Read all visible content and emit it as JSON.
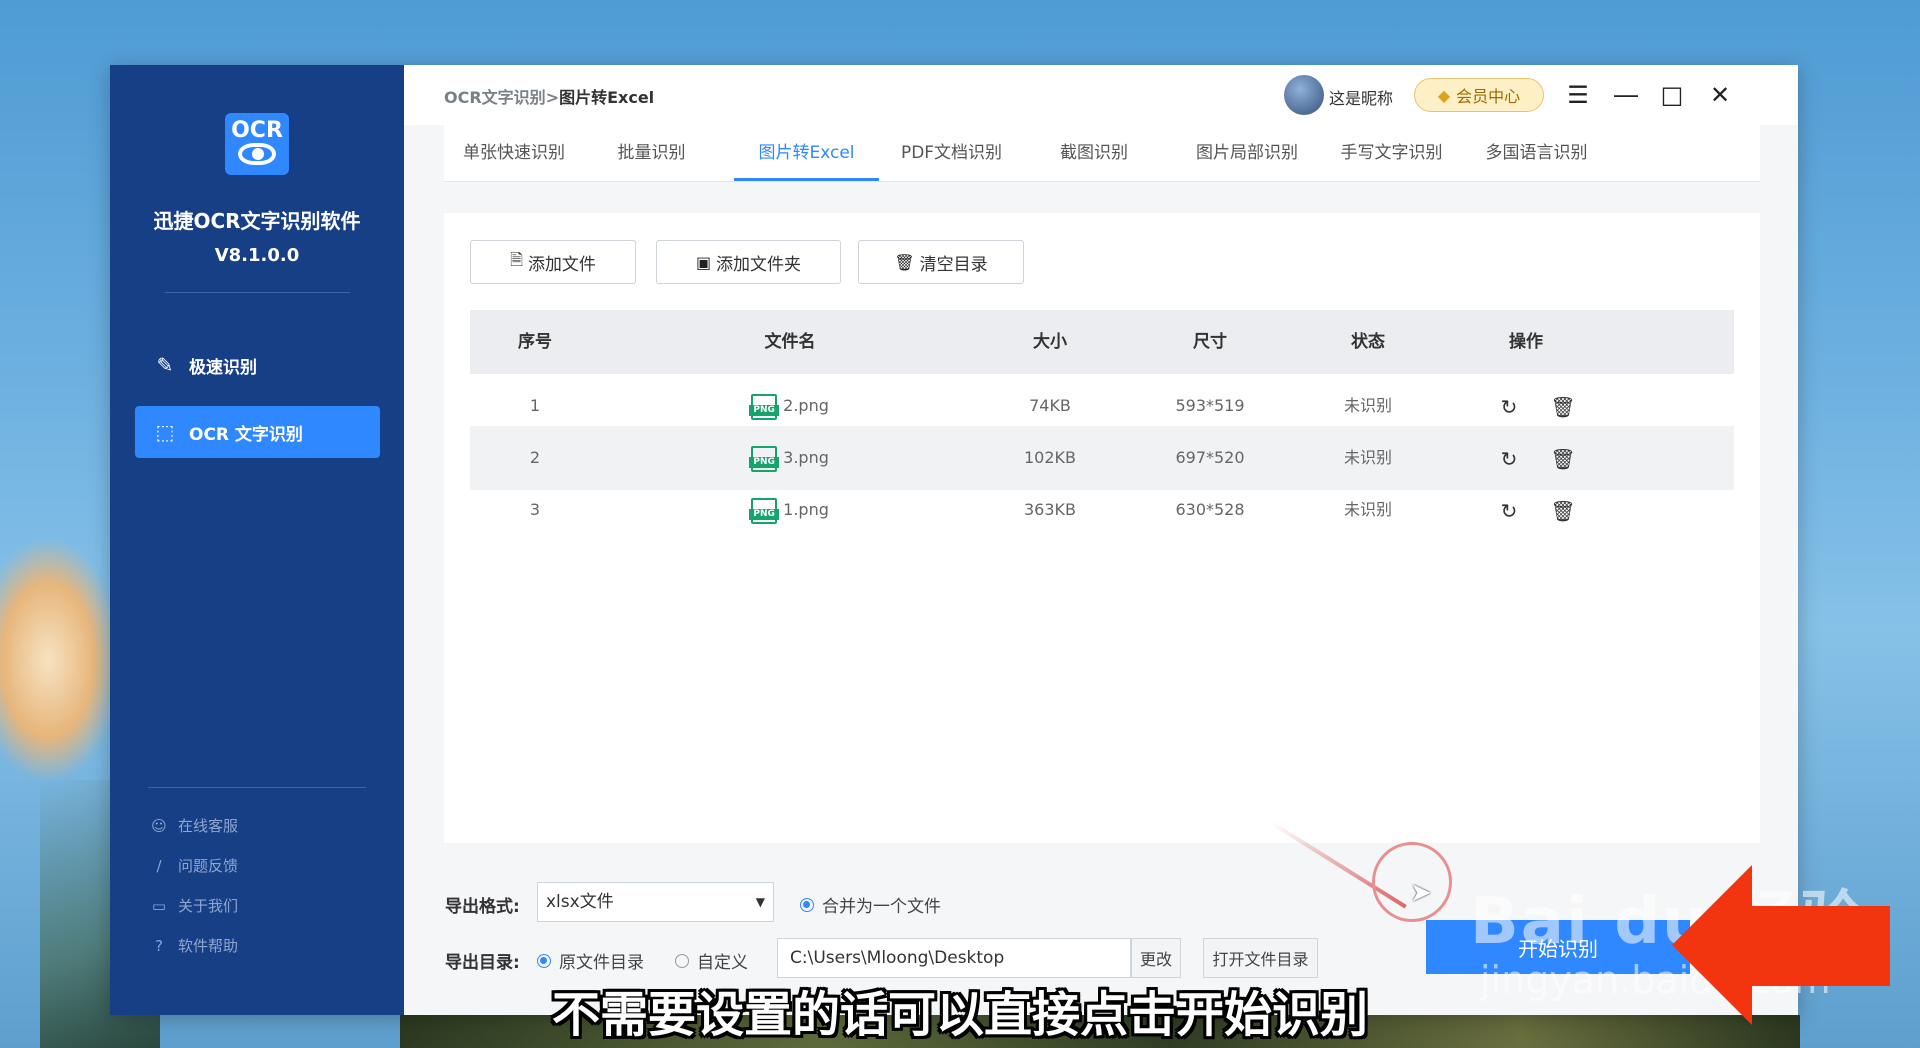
{
  "sidebar": {
    "logo_text": "OCR",
    "app_name": "迅捷OCR文字识别软件",
    "version": "V8.1.0.0",
    "nav": [
      {
        "label": "极速识别",
        "icon": "quick-scan-icon"
      },
      {
        "label": "OCR 文字识别",
        "icon": "ocr-scan-icon",
        "active": true
      }
    ],
    "footer": [
      {
        "label": "在线客服",
        "icon": "user-icon"
      },
      {
        "label": "问题反馈",
        "icon": "edit-icon"
      },
      {
        "label": "关于我们",
        "icon": "chat-icon"
      },
      {
        "label": "软件帮助",
        "icon": "question-icon"
      }
    ]
  },
  "header": {
    "breadcrumb_parent": "OCR文字识别",
    "breadcrumb_sep": ">",
    "breadcrumb_current": "图片转Excel",
    "nickname": "这是昵称",
    "vip_label": "会员中心"
  },
  "tabs": [
    "单张快速识别",
    "批量识别",
    "图片转Excel",
    "PDF文档识别",
    "截图识别",
    "图片局部识别",
    "手写文字识别",
    "多国语言识别"
  ],
  "active_tab": "图片转Excel",
  "toolbar": {
    "add_file": "添加文件",
    "add_folder": "添加文件夹",
    "clear": "清空目录"
  },
  "table": {
    "headers": [
      "序号",
      "文件名",
      "大小",
      "尺寸",
      "状态",
      "操作"
    ],
    "rows": [
      {
        "index": "1",
        "name": "2.png",
        "size": "74KB",
        "dims": "593*519",
        "status": "未识别"
      },
      {
        "index": "2",
        "name": "3.png",
        "size": "102KB",
        "dims": "697*520",
        "status": "未识别"
      },
      {
        "index": "3",
        "name": "1.png",
        "size": "363KB",
        "dims": "630*528",
        "status": "未识别"
      }
    ],
    "file_badge": "PNG"
  },
  "export": {
    "format_label": "导出格式:",
    "format_value": "xlsx文件",
    "merge_label": "合并为一个文件",
    "dir_label": "导出目录:",
    "dir_option_original": "原文件目录",
    "dir_option_custom": "自定义",
    "path": "C:\\Users\\Mloong\\Desktop",
    "change_btn": "更改",
    "open_btn": "打开文件目录",
    "start_btn": "开始识别"
  },
  "overlay": {
    "watermark": "Bai du 经验",
    "watermark_url": "jingyan.baidu.com",
    "subtitle": "不需要设置的话可以直接点击开始识别"
  },
  "colors": {
    "sidebar_bg": "#173f86",
    "accent": "#2f88ff",
    "red_arrow": "#f2350f"
  }
}
